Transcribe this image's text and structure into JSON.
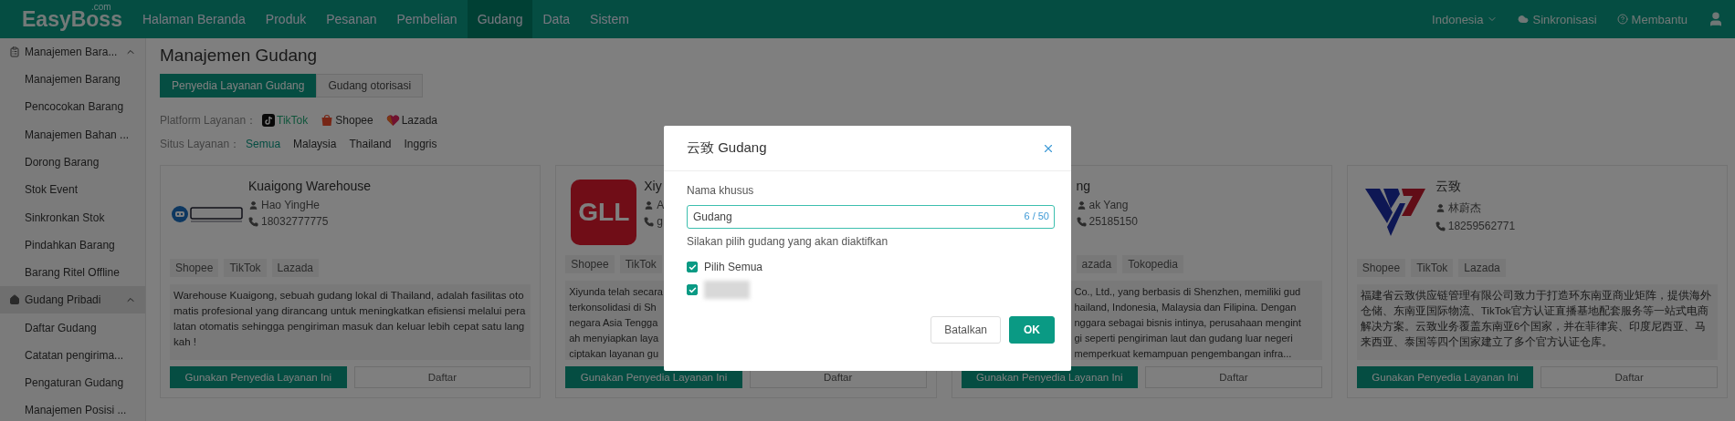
{
  "app": {
    "logo": "EasyBoss",
    "logo_suffix": ".com"
  },
  "nav": {
    "items": [
      {
        "label": "Halaman Beranda",
        "selected": false
      },
      {
        "label": "Produk",
        "selected": false
      },
      {
        "label": "Pesanan",
        "selected": false
      },
      {
        "label": "Pembelian",
        "selected": false
      },
      {
        "label": "Gudang",
        "selected": true
      },
      {
        "label": "Data",
        "selected": false
      },
      {
        "label": "Sistem",
        "selected": false
      }
    ],
    "language": "Indonesia",
    "sync": "Sinkronisasi",
    "help": "Membantu"
  },
  "sidebar": {
    "sections": [
      {
        "label": "Manajemen Bara...",
        "kind": "box",
        "expanded": true,
        "selected": false,
        "children": [
          {
            "label": "Manajemen Barang",
            "selected": false
          },
          {
            "label": "Pencocokan Barang",
            "selected": false
          },
          {
            "label": "Manajemen Bahan ...",
            "selected": false
          },
          {
            "label": "Dorong Barang",
            "selected": false
          },
          {
            "label": "Stok Event",
            "selected": false
          },
          {
            "label": "Sinkronkan Stok",
            "selected": false
          },
          {
            "label": "Pindahkan Barang",
            "selected": false
          },
          {
            "label": "Barang Ritel Offline",
            "selected": false
          }
        ]
      },
      {
        "label": "Gudang Pribadi",
        "kind": "house",
        "expanded": true,
        "selected": true,
        "children": [
          {
            "label": "Daftar Gudang",
            "selected": false
          },
          {
            "label": "Catatan pengirima...",
            "selected": false
          },
          {
            "label": "Pengaturan Gudang",
            "selected": false
          },
          {
            "label": "Manajemen Posisi ...",
            "selected": false
          }
        ]
      }
    ]
  },
  "page": {
    "title": "Manajemen Gudang",
    "tabs": [
      {
        "label": "Penyedia Layanan Gudang",
        "selected": true
      },
      {
        "label": "Gudang otorisasi",
        "selected": false
      }
    ],
    "platform_filter": {
      "label": "Platform Layanan：",
      "options": [
        {
          "label": "TikTok",
          "kind": "tiktok"
        },
        {
          "label": "Shopee",
          "kind": "shopee"
        },
        {
          "label": "Lazada",
          "kind": "lazada"
        }
      ]
    },
    "site_filter": {
      "label": "Situs Layanan：",
      "options": [
        {
          "label": "Semua",
          "selected": true
        },
        {
          "label": "Malaysia",
          "selected": false
        },
        {
          "label": "Thailand",
          "selected": false
        },
        {
          "label": "Inggris",
          "selected": false
        }
      ]
    },
    "cards": [
      {
        "kind": "full",
        "logo": {
          "kind": "robot"
        },
        "name": "Kuaigong Warehouse",
        "contact": "Hao YingHe",
        "phone": "18032777775",
        "tags": [
          "Shopee",
          "TikTok",
          "Lazada"
        ],
        "description": "Warehouse Kuaigong, sebuah gudang lokal di Thailand, adalah fasilitas otomatis profesional yang dirancang untuk meningkatkan efisiensi melalui peralatan otomatis sehingga  pengiriman masuk dan keluar lebih cepat satu langkah !",
        "use_button": "Gunakan Penyedia Layanan Ini",
        "list_button": "Daftar"
      },
      {
        "kind": "left_part",
        "logo": {
          "kind": "gll"
        },
        "logo_text": "GLL",
        "name": "Xiy",
        "contact": "A",
        "phone": "g",
        "tags": [
          "Shopee",
          "TikTok"
        ],
        "description_lines": [
          "Xiyunda telah secara",
          "terkonsolidasi di Sh",
          "negara Asia Tengga",
          "ah menyiapkan laya",
          "ciptakan layanan gu"
        ],
        "use_button": "Gunakan Penyedia Layanan Ini",
        "list_button": "Daftar"
      },
      {
        "kind": "right_part",
        "name": "ng",
        "contact": "ak Yang",
        "phone": "25185150",
        "tags": [
          "azada",
          "Tokopedia"
        ],
        "description_lines": [
          "Co., Ltd., yang berbasis di Shenzhen, memiliki gud",
          "hailand, Indonesia, Malaysia dan Filipina. Dengan",
          "nggara sebagai bisnis intinya, perusahaan mengint",
          "gi seperti pengiriman laut dan gudang luar negeri",
          "memperkuat kemampuan pengembangan infra..."
        ],
        "use_button": "Gunakan Penyedia Layanan Ini",
        "list_button": "Daftar"
      },
      {
        "kind": "full",
        "logo": {
          "kind": "triangle"
        },
        "name": "云致",
        "contact": "林蔚杰",
        "phone": "18259562771",
        "tags": [
          "Shopee",
          "TikTok",
          "Lazada"
        ],
        "description": "福建省云致供应链管理有限公司致力于打造环东南亚商业矩阵，提供海外仓储、东南亚国际物流、TikTok官方认证直播基地配套服务等一站式电商解决方案。云致业务覆盖东南亚6个国家，并在菲律宾、印度尼西亚、马来西亚、泰国等四个国家建立了多个官方认证仓库。",
        "use_button": "Gunakan Penyedia Layanan Ini",
        "list_button": "Daftar"
      }
    ]
  },
  "modal": {
    "title": "云致 Gudang",
    "name_label": "Nama khusus",
    "name_value": "Gudang",
    "name_counter": "6 / 50",
    "hint": "Silakan pilih gudang yang akan diaktifkan",
    "options": [
      {
        "kind": "text",
        "label": "Pilih Semua",
        "checked": true
      },
      {
        "kind": "blurred",
        "checked": true
      }
    ],
    "cancel": "Batalkan",
    "ok": "OK"
  }
}
